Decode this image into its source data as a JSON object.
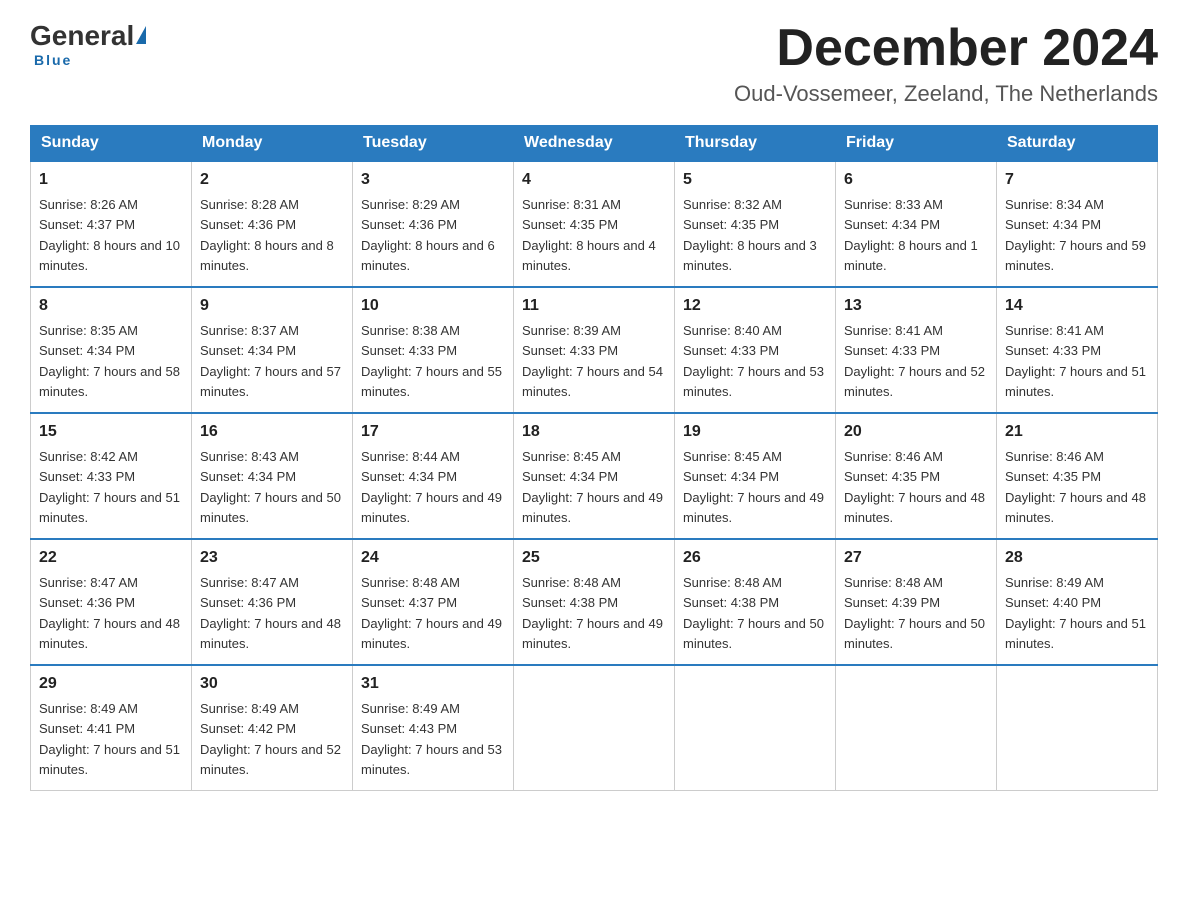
{
  "header": {
    "logo": {
      "general": "General",
      "triangle_char": "▶",
      "blue": "Blue",
      "underline": "Blue"
    },
    "title": "December 2024",
    "subtitle": "Oud-Vossemeer, Zeeland, The Netherlands"
  },
  "weekdays": [
    "Sunday",
    "Monday",
    "Tuesday",
    "Wednesday",
    "Thursday",
    "Friday",
    "Saturday"
  ],
  "weeks": [
    [
      {
        "day": "1",
        "sunrise": "8:26 AM",
        "sunset": "4:37 PM",
        "daylight": "8 hours and 10 minutes."
      },
      {
        "day": "2",
        "sunrise": "8:28 AM",
        "sunset": "4:36 PM",
        "daylight": "8 hours and 8 minutes."
      },
      {
        "day": "3",
        "sunrise": "8:29 AM",
        "sunset": "4:36 PM",
        "daylight": "8 hours and 6 minutes."
      },
      {
        "day": "4",
        "sunrise": "8:31 AM",
        "sunset": "4:35 PM",
        "daylight": "8 hours and 4 minutes."
      },
      {
        "day": "5",
        "sunrise": "8:32 AM",
        "sunset": "4:35 PM",
        "daylight": "8 hours and 3 minutes."
      },
      {
        "day": "6",
        "sunrise": "8:33 AM",
        "sunset": "4:34 PM",
        "daylight": "8 hours and 1 minute."
      },
      {
        "day": "7",
        "sunrise": "8:34 AM",
        "sunset": "4:34 PM",
        "daylight": "7 hours and 59 minutes."
      }
    ],
    [
      {
        "day": "8",
        "sunrise": "8:35 AM",
        "sunset": "4:34 PM",
        "daylight": "7 hours and 58 minutes."
      },
      {
        "day": "9",
        "sunrise": "8:37 AM",
        "sunset": "4:34 PM",
        "daylight": "7 hours and 57 minutes."
      },
      {
        "day": "10",
        "sunrise": "8:38 AM",
        "sunset": "4:33 PM",
        "daylight": "7 hours and 55 minutes."
      },
      {
        "day": "11",
        "sunrise": "8:39 AM",
        "sunset": "4:33 PM",
        "daylight": "7 hours and 54 minutes."
      },
      {
        "day": "12",
        "sunrise": "8:40 AM",
        "sunset": "4:33 PM",
        "daylight": "7 hours and 53 minutes."
      },
      {
        "day": "13",
        "sunrise": "8:41 AM",
        "sunset": "4:33 PM",
        "daylight": "7 hours and 52 minutes."
      },
      {
        "day": "14",
        "sunrise": "8:41 AM",
        "sunset": "4:33 PM",
        "daylight": "7 hours and 51 minutes."
      }
    ],
    [
      {
        "day": "15",
        "sunrise": "8:42 AM",
        "sunset": "4:33 PM",
        "daylight": "7 hours and 51 minutes."
      },
      {
        "day": "16",
        "sunrise": "8:43 AM",
        "sunset": "4:34 PM",
        "daylight": "7 hours and 50 minutes."
      },
      {
        "day": "17",
        "sunrise": "8:44 AM",
        "sunset": "4:34 PM",
        "daylight": "7 hours and 49 minutes."
      },
      {
        "day": "18",
        "sunrise": "8:45 AM",
        "sunset": "4:34 PM",
        "daylight": "7 hours and 49 minutes."
      },
      {
        "day": "19",
        "sunrise": "8:45 AM",
        "sunset": "4:34 PM",
        "daylight": "7 hours and 49 minutes."
      },
      {
        "day": "20",
        "sunrise": "8:46 AM",
        "sunset": "4:35 PM",
        "daylight": "7 hours and 48 minutes."
      },
      {
        "day": "21",
        "sunrise": "8:46 AM",
        "sunset": "4:35 PM",
        "daylight": "7 hours and 48 minutes."
      }
    ],
    [
      {
        "day": "22",
        "sunrise": "8:47 AM",
        "sunset": "4:36 PM",
        "daylight": "7 hours and 48 minutes."
      },
      {
        "day": "23",
        "sunrise": "8:47 AM",
        "sunset": "4:36 PM",
        "daylight": "7 hours and 48 minutes."
      },
      {
        "day": "24",
        "sunrise": "8:48 AM",
        "sunset": "4:37 PM",
        "daylight": "7 hours and 49 minutes."
      },
      {
        "day": "25",
        "sunrise": "8:48 AM",
        "sunset": "4:38 PM",
        "daylight": "7 hours and 49 minutes."
      },
      {
        "day": "26",
        "sunrise": "8:48 AM",
        "sunset": "4:38 PM",
        "daylight": "7 hours and 50 minutes."
      },
      {
        "day": "27",
        "sunrise": "8:48 AM",
        "sunset": "4:39 PM",
        "daylight": "7 hours and 50 minutes."
      },
      {
        "day": "28",
        "sunrise": "8:49 AM",
        "sunset": "4:40 PM",
        "daylight": "7 hours and 51 minutes."
      }
    ],
    [
      {
        "day": "29",
        "sunrise": "8:49 AM",
        "sunset": "4:41 PM",
        "daylight": "7 hours and 51 minutes."
      },
      {
        "day": "30",
        "sunrise": "8:49 AM",
        "sunset": "4:42 PM",
        "daylight": "7 hours and 52 minutes."
      },
      {
        "day": "31",
        "sunrise": "8:49 AM",
        "sunset": "4:43 PM",
        "daylight": "7 hours and 53 minutes."
      },
      null,
      null,
      null,
      null
    ]
  ]
}
